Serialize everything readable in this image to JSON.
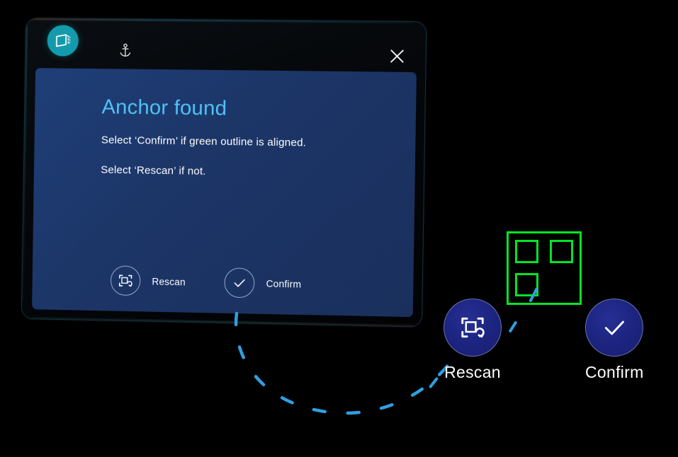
{
  "app": {
    "icon_name": "hologram-panel-icon",
    "accent_teal": "#149aad",
    "anchor_icon_name": "anchor-icon",
    "close_icon_name": "close-icon"
  },
  "dialog": {
    "title": "Anchor found",
    "title_color": "#4fc3f7",
    "panel_color": "#1c3668",
    "lines": [
      "Select ‘Confirm’ if green outline is aligned.",
      "Select ‘Rescan’ if not."
    ],
    "actions": [
      {
        "label": "Rescan",
        "icon": "rescan-frame-refresh-icon"
      },
      {
        "label": "Confirm",
        "icon": "checkmark-icon"
      }
    ]
  },
  "world": {
    "anchor_outline": {
      "name": "green-anchor-outline",
      "color": "#00e524",
      "corner_squares": 3
    },
    "buttons": [
      {
        "label": "Rescan",
        "icon": "rescan-frame-refresh-icon",
        "color": "#1c2480"
      },
      {
        "label": "Confirm",
        "icon": "checkmark-icon",
        "color": "#1c2480"
      }
    ],
    "connector": {
      "name": "dashed-connector-arc",
      "color": "#2f9fe0",
      "style": "dashed"
    }
  }
}
